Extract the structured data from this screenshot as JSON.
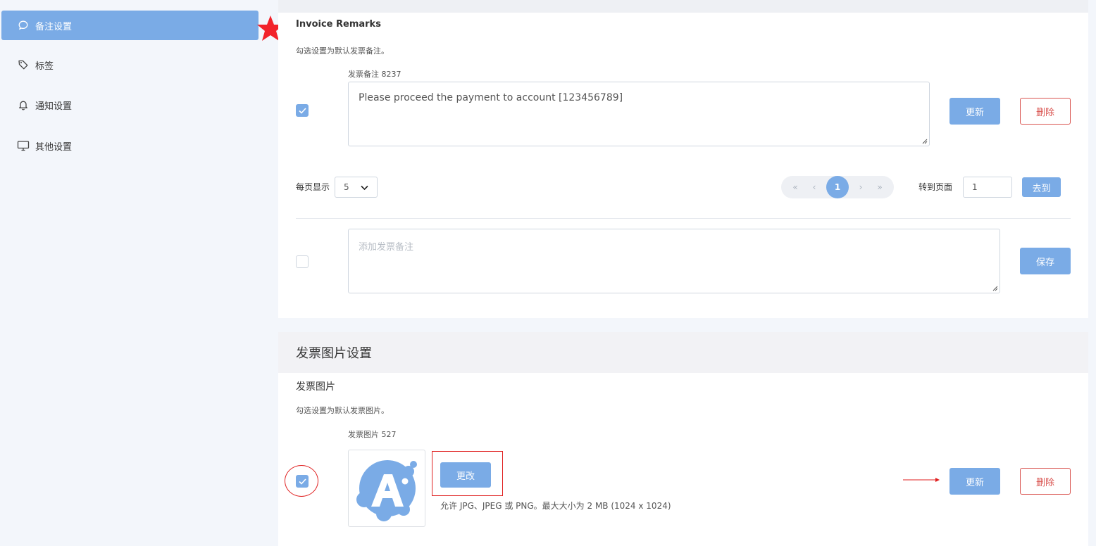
{
  "sidebar": {
    "items": [
      {
        "label": "备注设置",
        "icon": "chat-bubble-icon",
        "active": true
      },
      {
        "label": "标签",
        "icon": "tag-icon",
        "active": false
      },
      {
        "label": "通知设置",
        "icon": "bell-icon",
        "active": false
      },
      {
        "label": "其他设置",
        "icon": "monitor-icon",
        "active": false
      }
    ]
  },
  "remarks": {
    "title": "Invoice Remarks",
    "hint": "勾选设置为默认发票备注。",
    "item_label": "发票备注 8237",
    "item_text": "Please proceed the payment to account [123456789]",
    "item_checked": true,
    "update_label": "更新",
    "delete_label": "删除",
    "per_page_label": "每页显示",
    "per_page_value": "5",
    "pagination": {
      "first": "«",
      "prev": "‹",
      "current": "1",
      "next": "›",
      "last": "»"
    },
    "goto_label": "转到页面",
    "goto_value": "1",
    "goto_button": "去到",
    "new_placeholder": "添加发票备注",
    "new_checked": false,
    "save_label": "保存"
  },
  "image_settings": {
    "section_title": "发票图片设置",
    "title": "发票图片",
    "hint": "勾选设置为默认发票图片。",
    "item_label": "发票图片 527",
    "item_checked": true,
    "change_label": "更改",
    "allowed_note": "允许 JPG、JPEG 或 PNG。最大大小为 2 MB (1024 x 1024)",
    "update_label": "更新",
    "delete_label": "删除"
  },
  "colors": {
    "accent": "#7aabe6",
    "danger": "#d9534f",
    "annotation": "#e02020"
  }
}
